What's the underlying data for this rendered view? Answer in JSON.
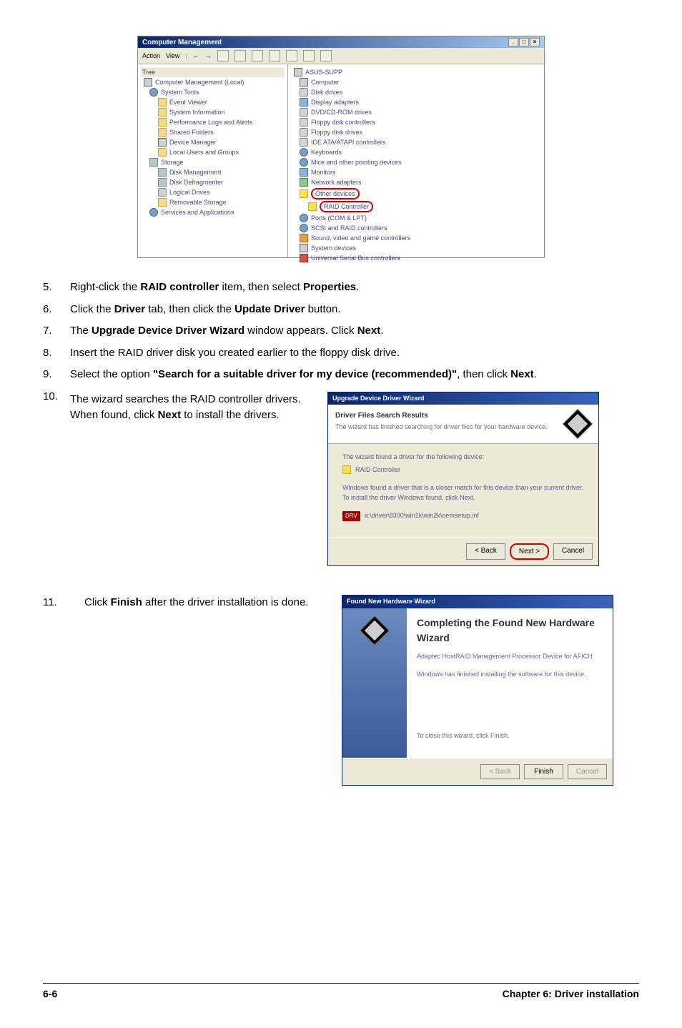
{
  "mgmt": {
    "title": "Computer Management",
    "menu": [
      "Action",
      "View"
    ],
    "treeHeader": "Tree",
    "tree": [
      {
        "l": 0,
        "ic": "ic-computer",
        "t": "Computer Management (Local)"
      },
      {
        "l": 1,
        "ic": "ic-gear",
        "t": "System Tools"
      },
      {
        "l": 2,
        "ic": "ic-folder",
        "t": "Event Viewer"
      },
      {
        "l": 2,
        "ic": "ic-folder",
        "t": "System Information"
      },
      {
        "l": 2,
        "ic": "ic-folder",
        "t": "Performance Logs and Alerts"
      },
      {
        "l": 2,
        "ic": "ic-folder",
        "t": "Shared Folders"
      },
      {
        "l": 2,
        "ic": "ic-computer",
        "t": "Device Manager"
      },
      {
        "l": 2,
        "ic": "ic-folder",
        "t": "Local Users and Groups"
      },
      {
        "l": 1,
        "ic": "ic-disk",
        "t": "Storage"
      },
      {
        "l": 2,
        "ic": "ic-disk",
        "t": "Disk Management"
      },
      {
        "l": 2,
        "ic": "ic-disk",
        "t": "Disk Defragmenter"
      },
      {
        "l": 2,
        "ic": "ic-drive",
        "t": "Logical Drives"
      },
      {
        "l": 2,
        "ic": "ic-folder",
        "t": "Removable Storage"
      },
      {
        "l": 1,
        "ic": "ic-gear",
        "t": "Services and Applications"
      }
    ],
    "detailRoot": "ASUS-SUPP",
    "details": [
      {
        "ic": "ic-computer",
        "t": "Computer"
      },
      {
        "ic": "ic-drive",
        "t": "Disk drives"
      },
      {
        "ic": "ic-monitor",
        "t": "Display adapters"
      },
      {
        "ic": "ic-drive",
        "t": "DVD/CD-ROM drives"
      },
      {
        "ic": "ic-drive",
        "t": "Floppy disk controllers"
      },
      {
        "ic": "ic-drive",
        "t": "Floppy disk drives"
      },
      {
        "ic": "ic-drive",
        "t": "IDE ATA/ATAPI controllers"
      },
      {
        "ic": "ic-gear",
        "t": "Keyboards"
      },
      {
        "ic": "ic-gear",
        "t": "Mice and other pointing devices"
      },
      {
        "ic": "ic-monitor",
        "t": "Monitors"
      },
      {
        "ic": "ic-net",
        "t": "Network adapters"
      },
      {
        "ic": "ic-yellow",
        "t": "Other devices",
        "hi": true
      },
      {
        "ic": "ic-yellow",
        "t": "RAID Controller",
        "child": true,
        "hi": true
      },
      {
        "ic": "ic-gear",
        "t": "Ports (COM & LPT)"
      },
      {
        "ic": "ic-gear",
        "t": "SCSI and RAID controllers"
      },
      {
        "ic": "ic-sound",
        "t": "Sound, video and game controllers"
      },
      {
        "ic": "ic-computer",
        "t": "System devices"
      },
      {
        "ic": "ic-red",
        "t": "Universal Serial Bus controllers"
      }
    ]
  },
  "steps": {
    "s5a": "Right-click the ",
    "s5b": "RAID controller",
    "s5c": " item, then select ",
    "s5d": "Properties",
    "s5e": ".",
    "s6a": "Click the ",
    "s6b": "Driver",
    "s6c": " tab, then click the ",
    "s6d": "Update Driver",
    "s6e": " button.",
    "s7a": "The ",
    "s7b": "Upgrade Device Driver Wizard",
    "s7c": " window appears. Click ",
    "s7d": "Next",
    "s7e": ".",
    "s8": "Insert the RAID driver disk you created earlier to the floppy disk drive.",
    "s9a": "Select the option ",
    "s9b": "\"Search for a suitable driver for my device (recommended)\"",
    "s9c": ", then click ",
    "s9d": "Next",
    "s9e": ".",
    "s10a": "The wizard searches the RAID controller drivers. When found, click ",
    "s10b": "Next",
    "s10c": " to install the drivers.",
    "s11a": "Click ",
    "s11b": "Finish",
    "s11c": " after the driver installation is done."
  },
  "wiz1": {
    "header": "Upgrade Device Driver Wizard",
    "bannerTitle": "Driver Files Search Results",
    "bannerSub": "The wizard has finished searching for driver files for your hardware device.",
    "found": "The wizard found a driver for the following device:",
    "device": "RAID Controller",
    "desc1": "Windows found a driver that is a closer match for this device than your current driver.",
    "desc2": "To install the driver Windows found, click Next.",
    "path": "a:\\driver\\8300\\win2k\\win2k\\oemsetup.inf",
    "back": "< Back",
    "next": "Next >",
    "cancel": "Cancel"
  },
  "wiz2": {
    "header": "Found New Hardware Wizard",
    "title": "Completing the Found New Hardware Wizard",
    "sub": "Adaptec HostRAID Management Processor Device for AFICH",
    "status": "Windows has finished installing the software for this device.",
    "close": "To close this wizard, click Finish.",
    "back": "< Back",
    "finish": "Finish",
    "cancel": "Cancel"
  },
  "footer": {
    "page": "6-6",
    "chapter": "Chapter 6: Driver installation"
  }
}
